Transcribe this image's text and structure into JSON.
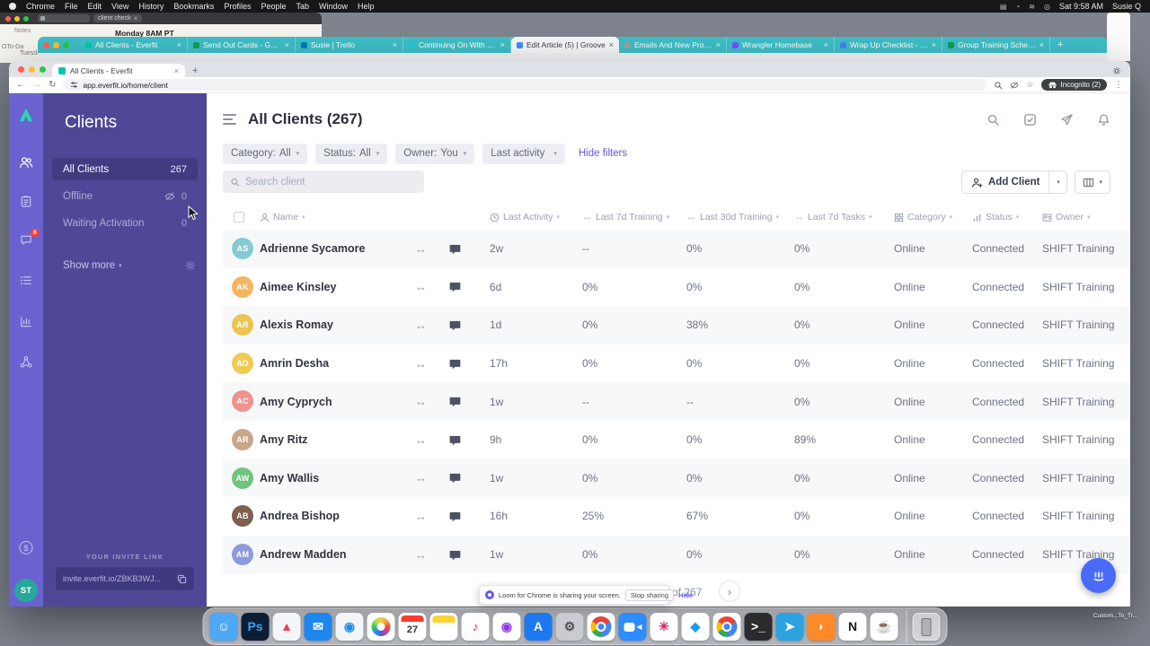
{
  "icons": {
    "close": "×",
    "caret": "▾",
    "plus": "+",
    "back": "←",
    "forward": "→",
    "reload": "↻",
    "dots": "⋮",
    "arrows": "↔",
    "chevron_right": "›",
    "star": "☆",
    "dollar": "$"
  },
  "menu_bar": {
    "items": [
      "Chrome",
      "File",
      "Edit",
      "View",
      "History",
      "Bookmarks",
      "Profiles",
      "People",
      "Tab",
      "Window",
      "Help"
    ],
    "status_icons": [
      "▤",
      "◔",
      "≋",
      "◎"
    ],
    "time": "Sat 9:58 AM",
    "user": "Susie Q"
  },
  "notes_window": {
    "notes_label": "Notes",
    "line1": "Monday 8AM PT",
    "todo": "OTo-Da",
    "tuesday": "Tuesday",
    "search": "client check"
  },
  "teal_tabs": [
    {
      "title": "All Clients - Everfit",
      "fav": "#00c7b0",
      "active": false
    },
    {
      "title": "Send Out Cards - Google Shee",
      "fav": "#0f9d58",
      "active": false
    },
    {
      "title": "Susie | Trello",
      "fav": "#0079bf",
      "active": false
    },
    {
      "title": "Continuing On With SHIFT Trai",
      "fav": "#26c6da",
      "active": false
    },
    {
      "title": "Edit Article (5) | Groove",
      "fav": "#3f8cff",
      "active": true
    },
    {
      "title": "Emails And New Process For C",
      "fav": "#9aa0a6",
      "active": false
    },
    {
      "title": "Wrangler Homebase",
      "fav": "#6f52ff",
      "active": false
    },
    {
      "title": "Wrap Up Checklist - Google D",
      "fav": "#4285f4",
      "active": false
    },
    {
      "title": "Group Training Schedule - Goo",
      "fav": "#0f9d58",
      "active": false
    }
  ],
  "browser": {
    "tab_title": "All Clients - Everfit",
    "url": "app.everfit.io/home/client",
    "incognito": "Incognito (2)"
  },
  "everfit": {
    "sidebar_title": "Clients",
    "sidebar_items": [
      {
        "label": "All Clients",
        "count": "267",
        "active": true
      },
      {
        "label": "Offline",
        "count": "0",
        "icon": "eye-off",
        "active": false
      },
      {
        "label": "Waiting Activation",
        "count": "0",
        "active": false
      }
    ],
    "show_more": "Show more",
    "invite_label": "YOUR INVITE LINK",
    "invite_link": "invite.everfit.io/ZBKB3WJ...",
    "rail_badge": "8",
    "avatar": "ST"
  },
  "main": {
    "title": "All Clients (267)",
    "filters": [
      {
        "label": "Category:",
        "value": "All"
      },
      {
        "label": "Status:",
        "value": "All"
      },
      {
        "label": "Owner:",
        "value": "You"
      },
      {
        "label": "Last activity",
        "value": ""
      }
    ],
    "hide_filters": "Hide filters",
    "search_placeholder": "Search client",
    "add_client": "Add Client",
    "headers": {
      "name": "Name",
      "activity": "Last Activity",
      "t7": "Last 7d Training",
      "t30": "Last 30d Training",
      "tasks": "Last 7d Tasks",
      "category": "Category",
      "status": "Status",
      "owner": "Owner"
    },
    "rows": [
      {
        "initials": "AS",
        "color": "#85cbd5",
        "name": "Adrienne Sycamore",
        "last_activity": "2w",
        "t7": "--",
        "t30": "0%",
        "tasks": "0%",
        "category": "Online",
        "status": "Connected",
        "owner": "SHIFT Training",
        "active": false
      },
      {
        "initials": "AK",
        "color": "#f3b55f",
        "name": "Aimee Kinsley",
        "last_activity": "6d",
        "t7": "0%",
        "t30": "0%",
        "tasks": "0%",
        "category": "Online",
        "status": "Connected",
        "owner": "SHIFT Training",
        "active": false
      },
      {
        "initials": "AR",
        "color": "#edc44f",
        "name": "Alexis Romay",
        "last_activity": "1d",
        "t7": "0%",
        "t30": "38%",
        "tasks": "0%",
        "category": "Online",
        "status": "Connected",
        "owner": "SHIFT Training",
        "active": false
      },
      {
        "initials": "AD",
        "color": "#eecb55",
        "name": "Amrin Desha",
        "last_activity": "17h",
        "t7": "0%",
        "t30": "0%",
        "tasks": "0%",
        "category": "Online",
        "status": "Connected",
        "owner": "SHIFT Training",
        "active": false
      },
      {
        "initials": "AC",
        "color": "#f0928e",
        "name": "Amy Cyprych",
        "last_activity": "1w",
        "t7": "--",
        "t30": "--",
        "tasks": "0%",
        "category": "Online",
        "status": "Connected",
        "owner": "SHIFT Training",
        "active": false
      },
      {
        "initials": "AR",
        "color": "#c9a68b",
        "name": "Amy Ritz",
        "last_activity": "9h",
        "t7": "0%",
        "t30": "0%",
        "tasks": "89%",
        "category": "Online",
        "status": "Connected",
        "owner": "SHIFT Training",
        "active": false
      },
      {
        "initials": "AW",
        "color": "#6fc47e",
        "name": "Amy Wallis",
        "last_activity": "1w",
        "t7": "0%",
        "t30": "0%",
        "tasks": "0%",
        "category": "Online",
        "status": "Connected",
        "owner": "SHIFT Training",
        "active": false
      },
      {
        "initials": "AB",
        "color": "#7d5f4f",
        "name": "Andrea Bishop",
        "last_activity": "16h",
        "t7": "25%",
        "t30": "67%",
        "tasks": "0%",
        "category": "Online",
        "status": "Connected",
        "owner": "SHIFT Training",
        "active": false
      },
      {
        "initials": "AM",
        "color": "#8e9adb",
        "name": "Andrew Madden",
        "last_activity": "1w",
        "t7": "0%",
        "t30": "0%",
        "tasks": "0%",
        "category": "Online",
        "status": "Connected",
        "owner": "SHIFT Training",
        "active": false
      }
    ],
    "pagination": {
      "of": "of 267"
    }
  },
  "loom": {
    "message": "Loom for Chrome is sharing your screen.",
    "stop": "Stop sharing",
    "hide": "Hide"
  },
  "dock": [
    {
      "name": "finder",
      "bg": "#4da8f5",
      "glyph": "☺",
      "fg": "#ffffff"
    },
    {
      "name": "photoshop",
      "bg": "#0c1e36",
      "glyph": "Ps",
      "fg": "#35a4f4"
    },
    {
      "name": "launchpad",
      "bg": "#f4f5f7",
      "glyph": "▲",
      "fg": "#e0455a"
    },
    {
      "name": "mail",
      "bg": "#1d86ef",
      "glyph": "✉",
      "fg": "#ffffff"
    },
    {
      "name": "safari",
      "bg": "#f4f5f7",
      "glyph": "◉",
      "fg": "#1f8ce8"
    },
    {
      "name": "photos",
      "bg": "#ffffff",
      "cls": "photos"
    },
    {
      "name": "calendar",
      "bg": "#ffffff",
      "cls": "calendar",
      "label": "27"
    },
    {
      "name": "notes",
      "bg": "#ffffff",
      "cls": "notes"
    },
    {
      "name": "music",
      "bg": "#ffffff",
      "glyph": "♪",
      "fg": "#fb2c55"
    },
    {
      "name": "podcasts",
      "bg": "#ffffff",
      "glyph": "◉",
      "fg": "#9137e7"
    },
    {
      "name": "app-store",
      "bg": "#1d79f2",
      "glyph": "A",
      "fg": "#ffffff"
    },
    {
      "name": "system-preferences",
      "bg": "#c9cbd1",
      "glyph": "⚙",
      "fg": "#4e5157"
    },
    {
      "name": "chrome",
      "bg": "#ffffff",
      "cls": "chrome"
    },
    {
      "name": "zoom",
      "bg": "#2d8cff",
      "cls": "zoom"
    },
    {
      "name": "slack",
      "bg": "#ffffff",
      "glyph": "✳",
      "fg": "#e01e5a"
    },
    {
      "name": "keynote",
      "bg": "#ffffff",
      "glyph": "◆",
      "fg": "#1d9bf0"
    },
    {
      "name": "chrome-profile",
      "bg": "#ffffff",
      "cls": "chrome"
    },
    {
      "name": "terminal",
      "bg": "#2b2b2e",
      "glyph": ">_",
      "fg": "#ffffff"
    },
    {
      "name": "telegram",
      "bg": "#2ba3e0",
      "glyph": "➤",
      "fg": "#ffffff"
    },
    {
      "name": "firefox",
      "bg": "#ff8a2a",
      "glyph": "◗",
      "fg": "#ffffff"
    },
    {
      "name": "notion",
      "bg": "#ffffff",
      "glyph": "N",
      "fg": "#1b1b1b"
    },
    {
      "name": "mug",
      "bg": "#ffffff",
      "glyph": "☕",
      "fg": "#6f4e37"
    },
    {
      "name": "trash",
      "bg": "rgba(255,255,255,0.45)",
      "cls": "trash"
    }
  ],
  "desktop": {
    "corner_file": "Custom...To_Tr..."
  }
}
